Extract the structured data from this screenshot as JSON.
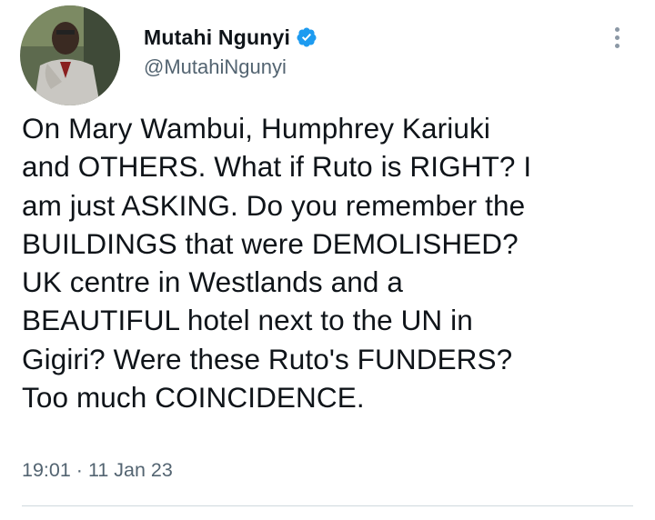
{
  "tweet": {
    "author": {
      "display_name": "Mutahi Ngunyi",
      "handle": "@MutahiNgunyi",
      "verified": true,
      "avatar_icon": "profile-photo"
    },
    "more_icon": "more-options-icon",
    "text": "On Mary Wambui, Humphrey Kariuki\nand OTHERS. What if Ruto is RIGHT? I\nam just ASKING. Do you remember the\nBUILDINGS that were DEMOLISHED?\nUK centre in Westlands and a\nBEAUTIFUL hotel next to the UN in\nGigiri? Were these Ruto's FUNDERS?\nToo much COINCIDENCE.",
    "time": "19:01",
    "separator": "·",
    "date": "11 Jan 23"
  },
  "colors": {
    "verified_badge": "#1d9bf0",
    "secondary_text": "#536471",
    "primary_text": "#0f1419",
    "divider": "#cfd9de"
  }
}
